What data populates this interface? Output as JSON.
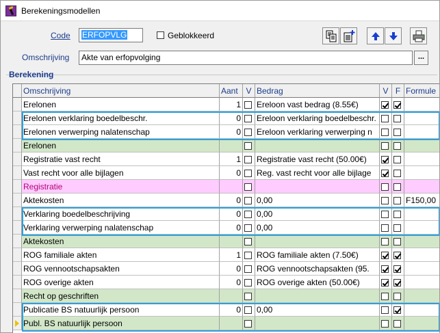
{
  "window": {
    "title": "Berekeningsmodellen"
  },
  "form": {
    "code_label": "Code",
    "code_value": "ERFOPVLG",
    "geblokkeerd_label": "Geblokkeerd",
    "geblokkeerd_checked": false,
    "omschrijving_label": "Omschrijving",
    "omschrijving_value": "Akte van erfopvolging",
    "ellipsis_label": "..."
  },
  "toolbar": {
    "icons": [
      "copy-icon",
      "new-record-icon",
      "arrow-up-icon",
      "arrow-down-icon",
      "printer-icon"
    ]
  },
  "section": {
    "label": "Berekening"
  },
  "table": {
    "headers": {
      "omschrijving": "Omschrijving",
      "aant": "Aant",
      "v": "V",
      "bedrag": "Bedrag",
      "v2": "V",
      "f": "F",
      "formule": "Formule"
    },
    "rows": [
      {
        "omschrijving": "Erelonen",
        "aant": "1",
        "v": false,
        "bedrag": "Ereloon vast bedrag (8.55€)",
        "v2": true,
        "f": true,
        "formule": "",
        "type": "normal"
      },
      {
        "omschrijving": "Erelonen verklaring boedelbeschr.",
        "aant": "0",
        "v": false,
        "bedrag": "Ereloon verklaring boedelbeschr.",
        "v2": false,
        "f": false,
        "formule": "",
        "type": "normal"
      },
      {
        "omschrijving": "Erelonen verwerping nalatenschap",
        "aant": "0",
        "v": false,
        "bedrag": "Ereloon verklaring verwerping n",
        "v2": false,
        "f": false,
        "formule": "",
        "type": "normal"
      },
      {
        "omschrijving": "Erelonen",
        "aant": "",
        "v": false,
        "bedrag": "",
        "v2": false,
        "f": false,
        "formule": "",
        "type": "green"
      },
      {
        "omschrijving": "Registratie vast recht",
        "aant": "1",
        "v": false,
        "bedrag": "Registratie vast recht (50.00€)",
        "v2": true,
        "f": false,
        "formule": "",
        "type": "normal"
      },
      {
        "omschrijving": "Vast recht voor alle bijlagen",
        "aant": "0",
        "v": false,
        "bedrag": "Reg. vast recht voor alle bijlage",
        "v2": true,
        "f": false,
        "formule": "",
        "type": "normal"
      },
      {
        "omschrijving": "Registratie",
        "aant": "",
        "v": false,
        "bedrag": "",
        "v2": false,
        "f": false,
        "formule": "",
        "type": "pink"
      },
      {
        "omschrijving": "Aktekosten",
        "aant": "0",
        "v": false,
        "bedrag": "0,00",
        "v2": false,
        "f": false,
        "formule": "F150,00",
        "type": "normal"
      },
      {
        "omschrijving": "Verklaring boedelbeschrijving",
        "aant": "0",
        "v": false,
        "bedrag": "0,00",
        "v2": false,
        "f": false,
        "formule": "",
        "type": "normal"
      },
      {
        "omschrijving": "Verklaring verwerping nalatenschap",
        "aant": "0",
        "v": false,
        "bedrag": "0,00",
        "v2": false,
        "f": false,
        "formule": "",
        "type": "normal"
      },
      {
        "omschrijving": "Aktekosten",
        "aant": "",
        "v": false,
        "bedrag": "",
        "v2": false,
        "f": false,
        "formule": "",
        "type": "green"
      },
      {
        "omschrijving": "ROG familiale akten",
        "aant": "1",
        "v": false,
        "bedrag": "ROG familiale akten (7.50€)",
        "v2": true,
        "f": true,
        "formule": "",
        "type": "normal"
      },
      {
        "omschrijving": "ROG vennootschapsakten",
        "aant": "0",
        "v": false,
        "bedrag": "ROG vennootschapsakten (95.",
        "v2": true,
        "f": true,
        "formule": "",
        "type": "normal"
      },
      {
        "omschrijving": "ROG overige akten",
        "aant": "0",
        "v": false,
        "bedrag": "ROG overige akten (50.00€)",
        "v2": true,
        "f": true,
        "formule": "",
        "type": "normal"
      },
      {
        "omschrijving": "Recht op geschriften",
        "aant": "",
        "v": false,
        "bedrag": "",
        "v2": false,
        "f": false,
        "formule": "",
        "type": "green"
      },
      {
        "omschrijving": "Publicatie BS natuurlijk persoon",
        "aant": "0",
        "v": false,
        "bedrag": "0,00",
        "v2": false,
        "f": true,
        "formule": "",
        "type": "normal"
      },
      {
        "omschrijving": "Publ. BS natuurlijk persoon",
        "aant": "",
        "v": false,
        "bedrag": "",
        "v2": false,
        "f": false,
        "formule": "",
        "type": "green",
        "current": true
      }
    ]
  },
  "colors": {
    "accent": "#1b3c8c",
    "highlight_border": "#2ca0dc",
    "green_row": "#d2e7c8",
    "pink_row": "#ffccff"
  }
}
